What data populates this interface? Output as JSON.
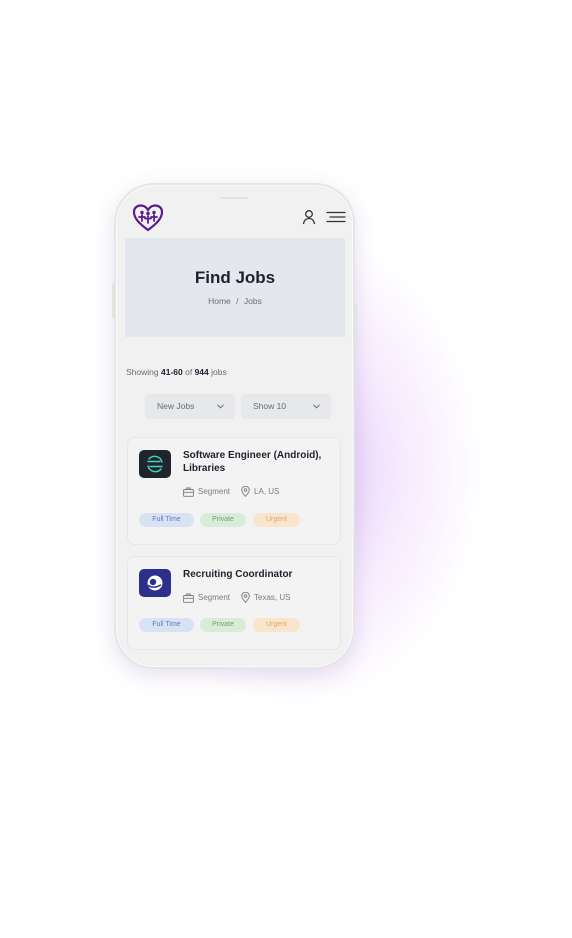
{
  "header": {
    "logo_icon": "heart-people-logo",
    "user_icon": "user-icon",
    "menu_icon": "hamburger-menu-icon"
  },
  "hero": {
    "title": "Find Jobs",
    "breadcrumb": {
      "home": "Home",
      "separator": "/",
      "current": "Jobs"
    }
  },
  "results": {
    "prefix": "Showing",
    "range": "41-60",
    "of": "of",
    "total": "944",
    "suffix": "jobs"
  },
  "filters": {
    "sort": "New Jobs",
    "per_page": "Show 10"
  },
  "jobs": [
    {
      "title": "Software Engineer (Android), Libraries",
      "company": "Segment",
      "location": "LA, US",
      "logo_color": "#1e2530",
      "tags": [
        "Full Time",
        "Private",
        "Urgent"
      ]
    },
    {
      "title": "Recruiting Coordinator",
      "company": "Segment",
      "location": "Texas, US",
      "logo_color": "#2d2f8c",
      "tags": [
        "Full Time",
        "Private",
        "Urgent"
      ]
    }
  ],
  "colors": {
    "brand": "#5b1a8f",
    "accent_glow": "#ce96f5",
    "tag_blue": "#5e7bc4",
    "tag_green": "#6aa370",
    "tag_orange": "#e8a65d"
  }
}
